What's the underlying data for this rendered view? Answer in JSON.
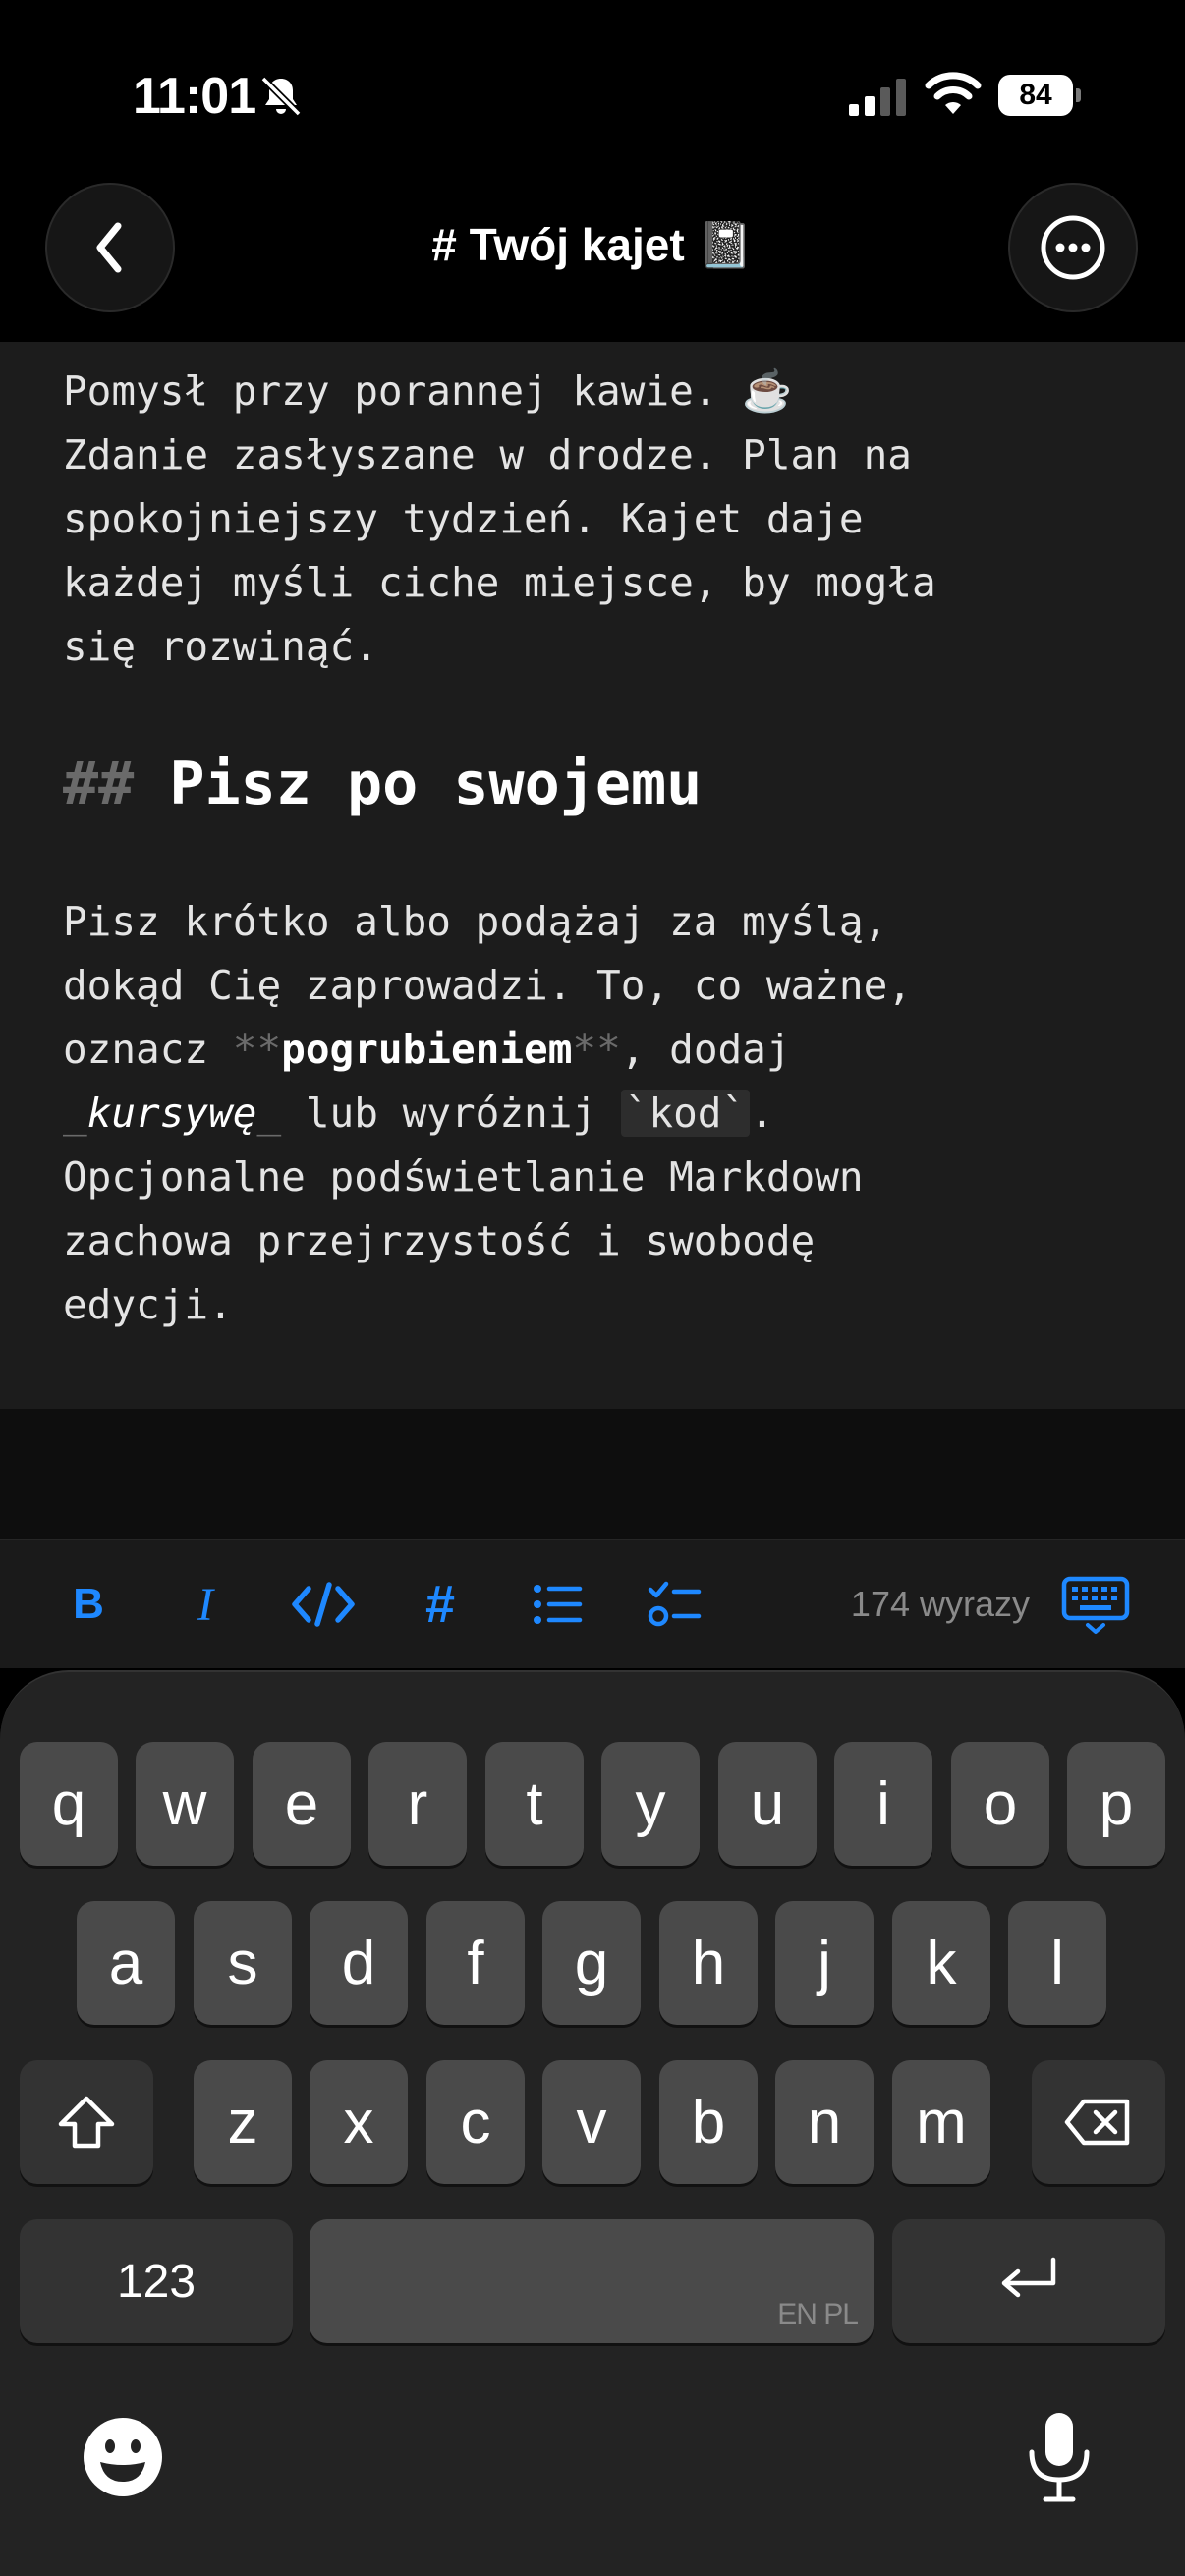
{
  "status_bar": {
    "time": "11:01",
    "battery": "84"
  },
  "nav": {
    "title": "# Twój kajet 📓"
  },
  "editor": {
    "para1_lines": [
      "Pomysł przy porannej kawie. ☕️",
      "Zdanie zasłyszane w drodze. Plan na",
      "spokojniejszy tydzień. Kajet daje",
      "każdej myśli ciche miejsce, by mogła",
      "się rozwinąć."
    ],
    "heading_marker": "##",
    "heading_text": "Pisz po swojemu",
    "para2": {
      "l1": "Pisz krótko albo podążaj za myślą,",
      "l2": "dokąd Cię zaprowadzi. To, co ważne,",
      "l3_pre": "oznacz ",
      "bold_open": "**",
      "bold_word": "pogrubieniem",
      "bold_close": "**",
      "l3_post": ", dodaj",
      "italic_open": "_",
      "italic_word": "kursywę",
      "italic_close": "_",
      "l4_mid": " lub wyróżnij ",
      "code": "`kod`",
      "l4_post": ".",
      "l5": "Opcjonalne podświetlanie Markdown",
      "l6": "zachowa przejrzystość i swobodę",
      "l7": "edycji."
    }
  },
  "toolbar": {
    "bold": "B",
    "italic": "I",
    "heading": "#",
    "word_count": "174 wyrazy",
    "accent_color": "#1e88ff"
  },
  "keyboard": {
    "row1": [
      "q",
      "w",
      "e",
      "r",
      "t",
      "y",
      "u",
      "i",
      "o",
      "p"
    ],
    "row2": [
      "a",
      "s",
      "d",
      "f",
      "g",
      "h",
      "j",
      "k",
      "l"
    ],
    "row3": [
      "z",
      "x",
      "c",
      "v",
      "b",
      "n",
      "m"
    ],
    "numbers_key": "123",
    "space_label": "EN PL"
  }
}
